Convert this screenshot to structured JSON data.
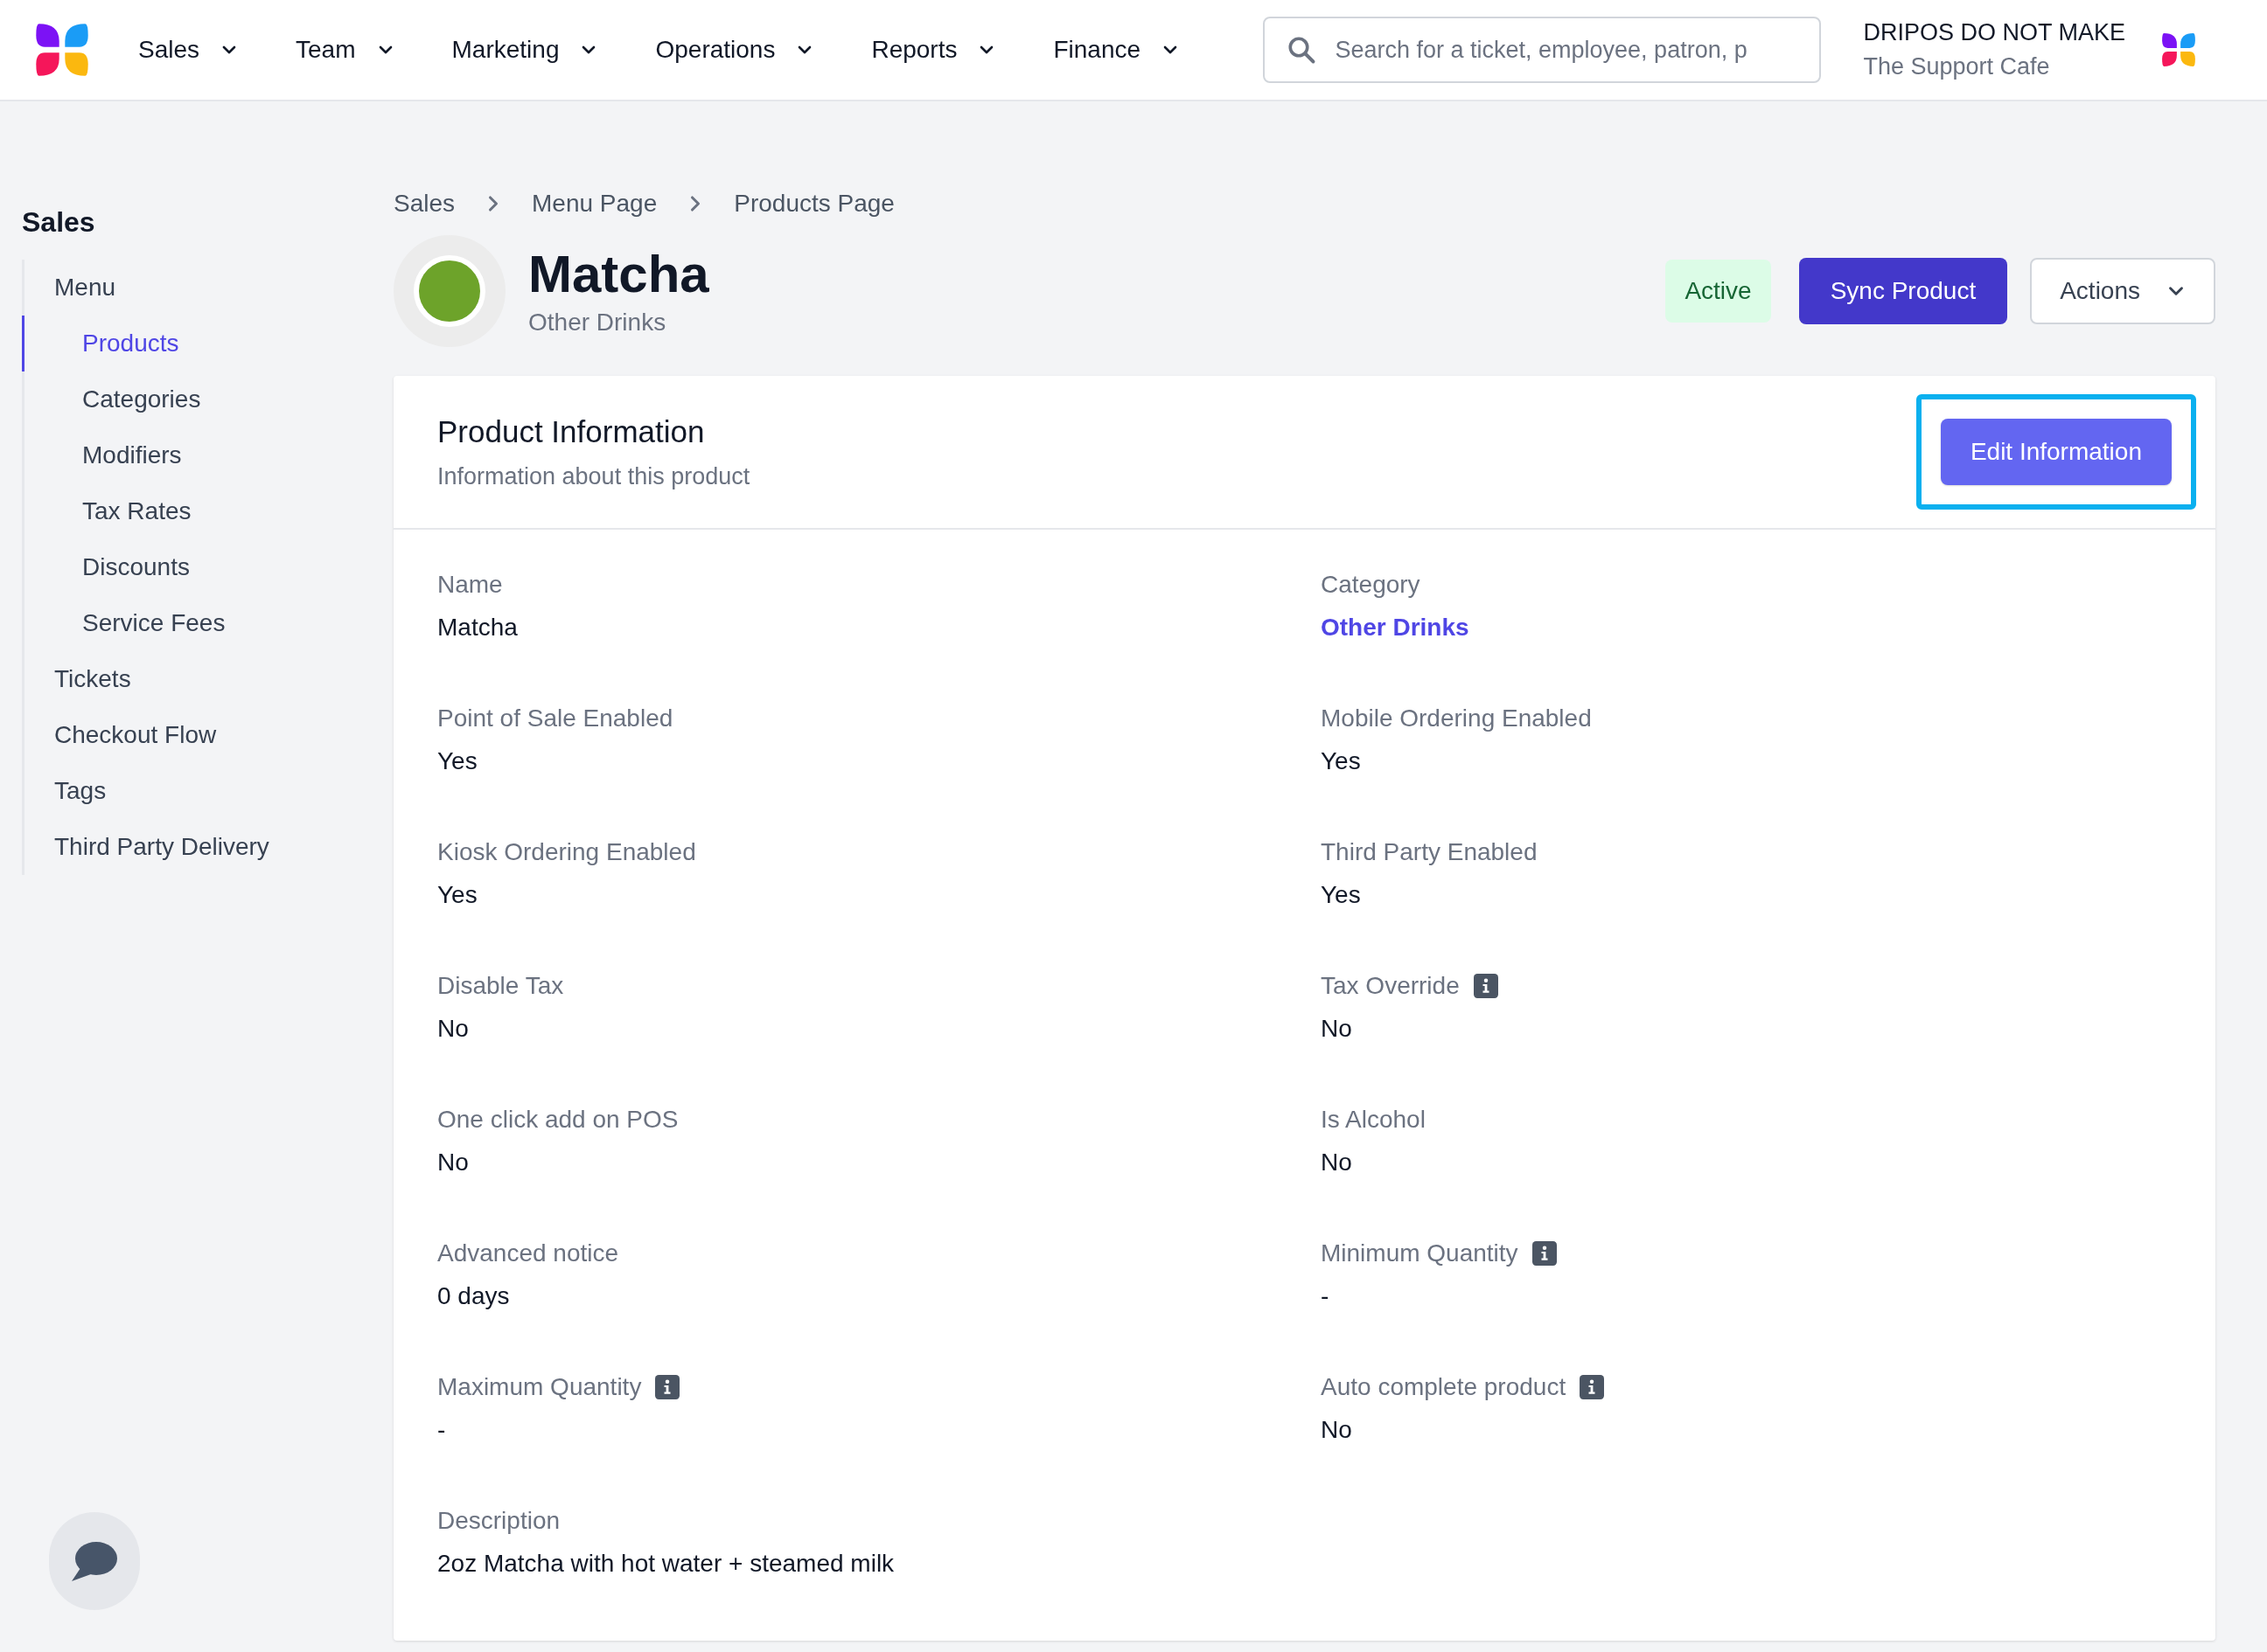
{
  "nav": {
    "items": [
      {
        "label": "Sales"
      },
      {
        "label": "Team"
      },
      {
        "label": "Marketing"
      },
      {
        "label": "Operations"
      },
      {
        "label": "Reports"
      },
      {
        "label": "Finance"
      }
    ],
    "search": {
      "placeholder": "Search for a ticket, employee, patron, p"
    },
    "account": {
      "name": "DRIPOS DO NOT MAKE",
      "location": "The Support Cafe"
    }
  },
  "sidebar": {
    "title": "Sales",
    "items": [
      {
        "label": "Menu",
        "selected": false,
        "children": [
          {
            "label": "Products",
            "selected": true
          },
          {
            "label": "Categories",
            "selected": false
          },
          {
            "label": "Modifiers",
            "selected": false
          },
          {
            "label": "Tax Rates",
            "selected": false
          },
          {
            "label": "Discounts",
            "selected": false
          },
          {
            "label": "Service Fees",
            "selected": false
          }
        ]
      },
      {
        "label": "Tickets",
        "selected": false
      },
      {
        "label": "Checkout Flow",
        "selected": false
      },
      {
        "label": "Tags",
        "selected": false
      },
      {
        "label": "Third Party Delivery",
        "selected": false
      }
    ]
  },
  "breadcrumb": [
    "Sales",
    "Menu Page",
    "Products Page"
  ],
  "header": {
    "title": "Matcha",
    "subtitle": "Other Drinks",
    "status": "Active",
    "buttons": [
      {
        "label": "Sync Product",
        "kind": "primary"
      },
      {
        "label": "Actions",
        "kind": "dropdown"
      }
    ]
  },
  "card": {
    "title": "Product Information",
    "description": "Information about this product",
    "edit_button": {
      "label": "Edit Information",
      "highlighted": true
    },
    "fields": [
      {
        "label": "Name",
        "value": "Matcha",
        "kind": "text",
        "info": false
      },
      {
        "label": "Category",
        "value": "Other Drinks",
        "kind": "link",
        "info": false
      },
      {
        "label": "Point of Sale Enabled",
        "value": "Yes",
        "kind": "text",
        "info": false
      },
      {
        "label": "Mobile Ordering Enabled",
        "value": "Yes",
        "kind": "text",
        "info": false
      },
      {
        "label": "Kiosk Ordering Enabled",
        "value": "Yes",
        "kind": "text",
        "info": false
      },
      {
        "label": "Third Party Enabled",
        "value": "Yes",
        "kind": "text",
        "info": false
      },
      {
        "label": "Disable Tax",
        "value": "No",
        "kind": "text",
        "info": false
      },
      {
        "label": "Tax Override",
        "value": "No",
        "kind": "text",
        "info": true
      },
      {
        "label": "One click add on POS",
        "value": "No",
        "kind": "text",
        "info": false
      },
      {
        "label": "Is Alcohol",
        "value": "No",
        "kind": "text",
        "info": false
      },
      {
        "label": "Advanced notice",
        "value": "0 days",
        "kind": "text",
        "info": false
      },
      {
        "label": "Minimum Quantity",
        "value": "-",
        "kind": "text",
        "info": true
      },
      {
        "label": "Maximum Quantity",
        "value": "-",
        "kind": "text",
        "info": true
      },
      {
        "label": "Auto complete product",
        "value": "No",
        "kind": "text",
        "info": true
      },
      {
        "label": "Description",
        "value": "2oz Matcha with hot water + steamed milk",
        "kind": "text",
        "info": false
      }
    ]
  }
}
